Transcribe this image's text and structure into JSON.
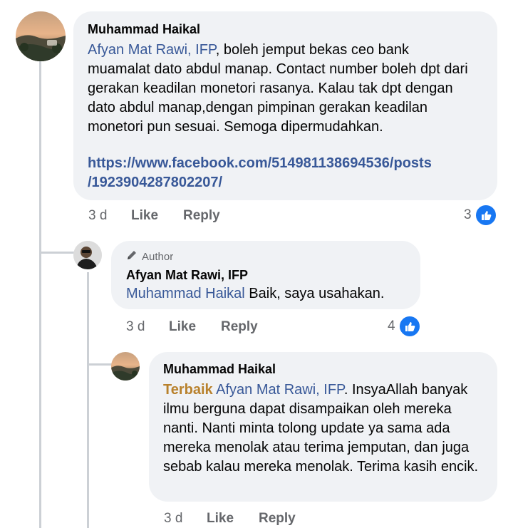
{
  "comments": [
    {
      "author": "Muhammad Haikal",
      "mention": "Afyan Mat Rawi, IFP",
      "text": ", boleh jemput bekas ceo bank muamalat dato abdul manap. Contact number boleh dpt dari gerakan keadilan monetori rasanya. Kalau tak dpt dengan dato abdul manap,dengan pimpinan gerakan keadilan monetori pun sesuai. Semoga dipermudahkan.",
      "link_line1": "https://www.facebook.com/514981138694536/posts",
      "link_line2": "/1923904287802207/",
      "time": "3 d",
      "like_label": "Like",
      "reply_label": "Reply",
      "reaction_count": "3"
    },
    {
      "badge": "Author",
      "author": "Afyan Mat Rawi, IFP",
      "mention": "Muhammad Haikal",
      "text": " Baik, saya usahakan.",
      "time": "3 d",
      "like_label": "Like",
      "reply_label": "Reply",
      "reaction_count": "4"
    },
    {
      "author": "Muhammad Haikal",
      "tag": "Terbaik",
      "mention": "Afyan Mat Rawi, IFP",
      "text": ". InsyaAllah banyak ilmu berguna dapat disampaikan oleh mereka nanti. Nanti minta tolong update ya sama ada mereka menolak atau terima jemputan, dan juga sebab kalau mereka menolak. Terima kasih encik.",
      "time": "3 d",
      "like_label": "Like",
      "reply_label": "Reply"
    }
  ],
  "icons": {
    "like": "thumbs-up-icon",
    "author_badge": "pencil-icon"
  },
  "colors": {
    "bubble": "#f0f2f5",
    "mention": "#385898",
    "like_badge": "#1877f2",
    "terbaik": "#b8812c"
  }
}
